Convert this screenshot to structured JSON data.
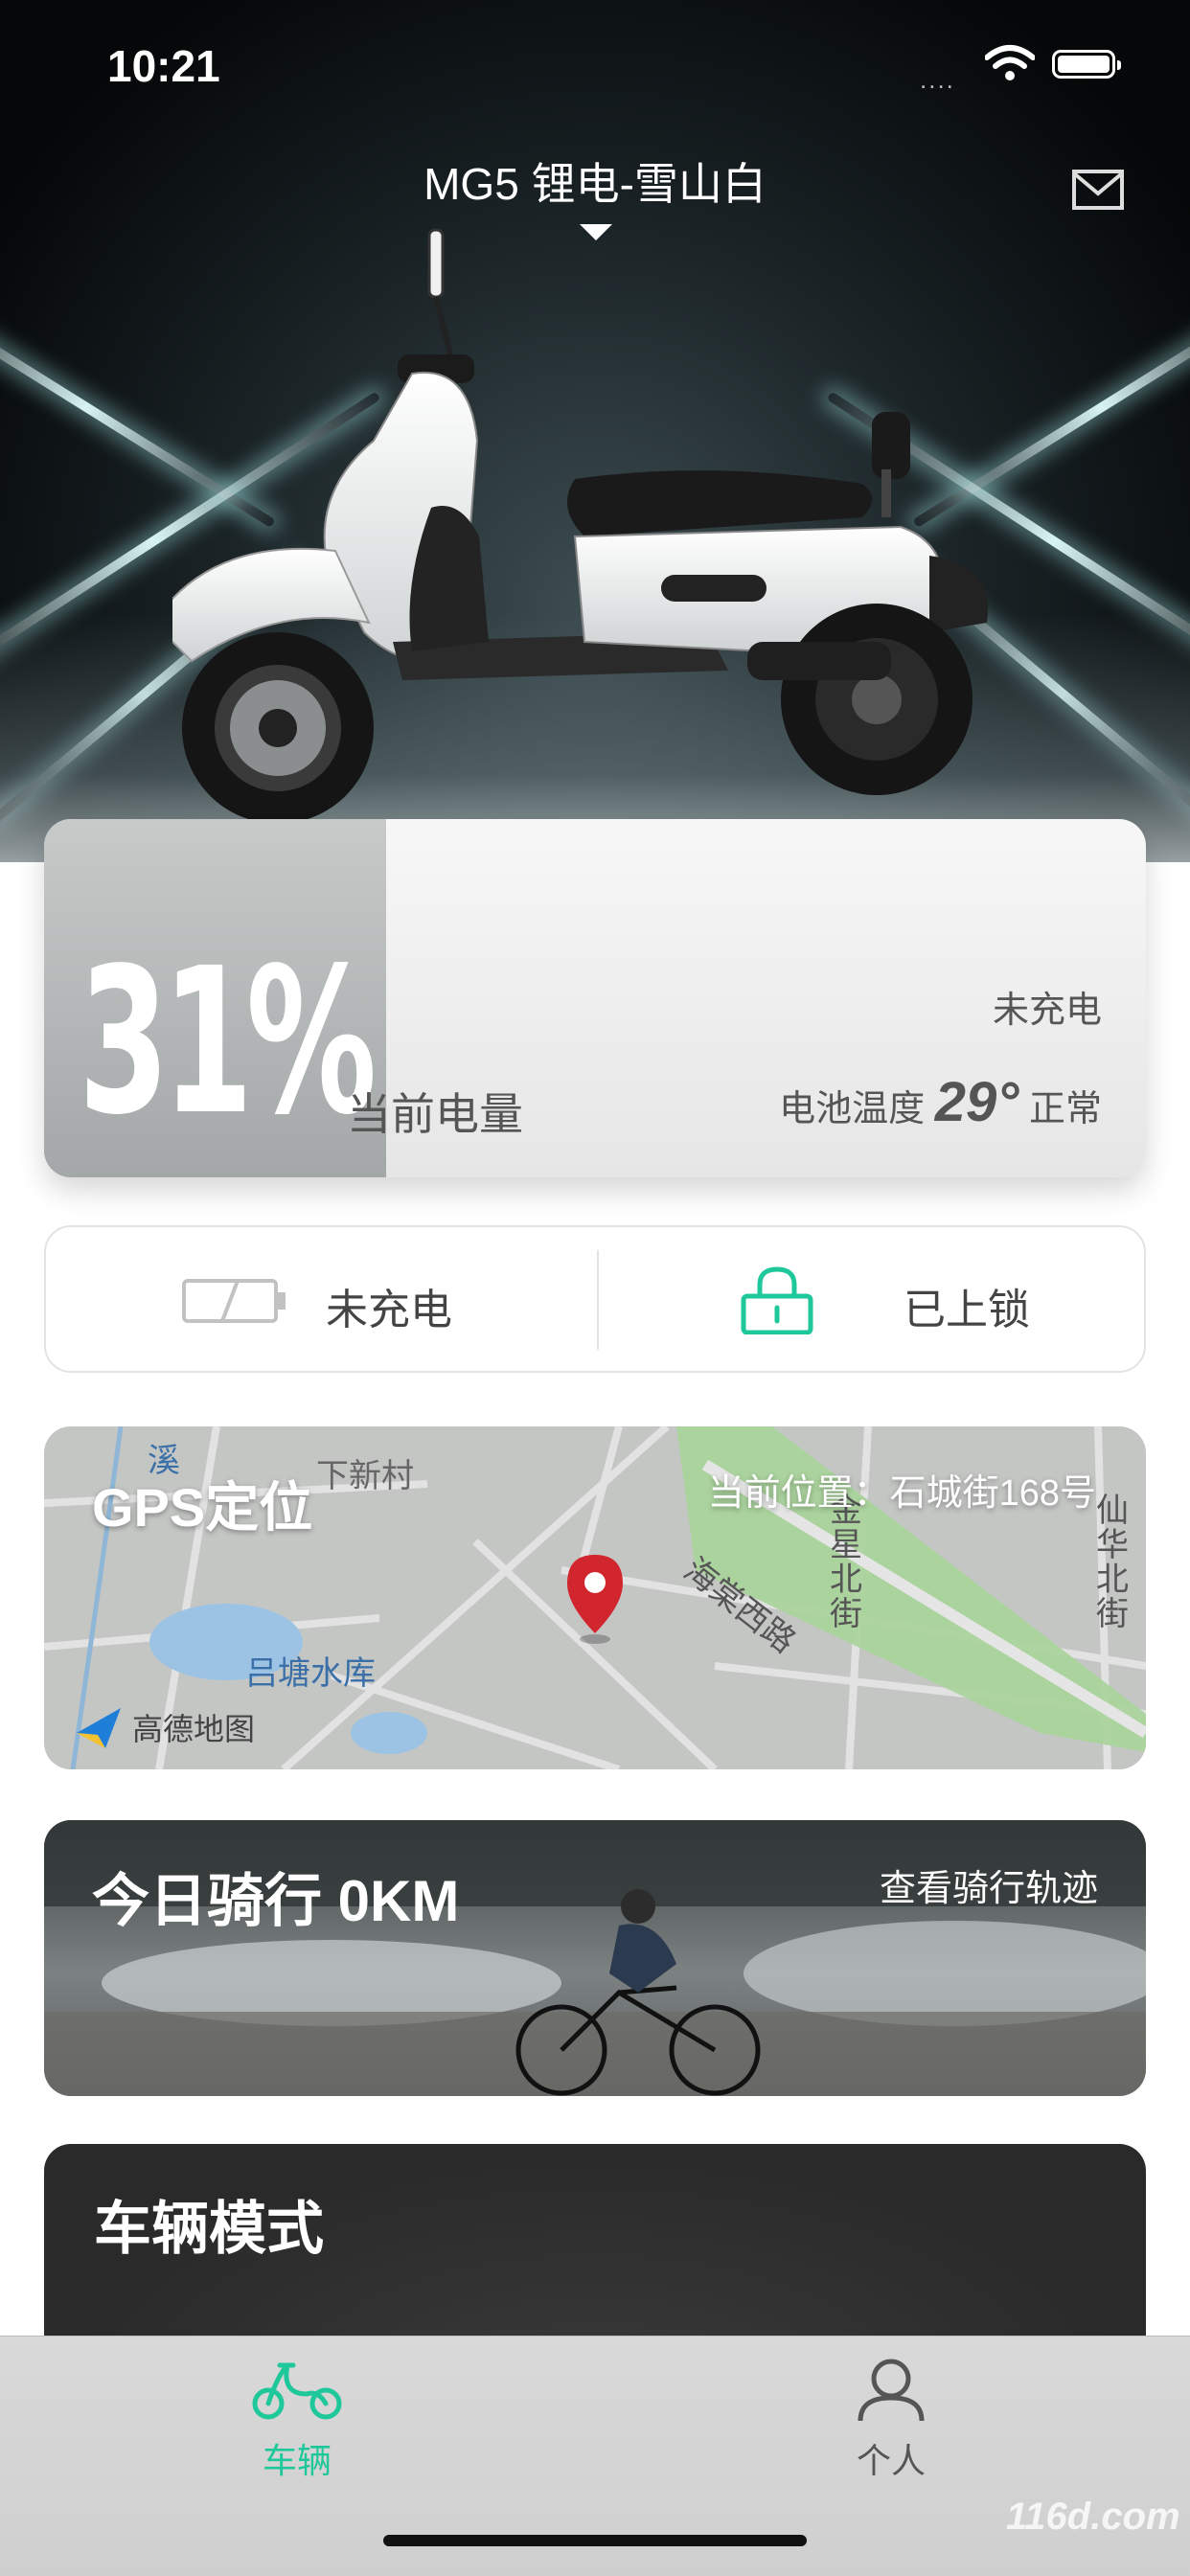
{
  "status_bar": {
    "time": "10:21",
    "signal": "....",
    "wifi_icon": "wifi-icon",
    "battery_icon": "battery-icon"
  },
  "header": {
    "vehicle_name": "MG5 锂电-雪山白",
    "dropdown_icon": "caret-down-icon",
    "message_icon": "mail-icon"
  },
  "battery_card": {
    "percent": "31%",
    "percent_value": 31,
    "label": "当前电量",
    "charge_status": "未充电",
    "temp_label": "电池温度",
    "temp_value": "29°",
    "temp_status": "正常"
  },
  "status_row": {
    "charge": {
      "label": "未充电",
      "icon": "battery-outline-icon"
    },
    "lock": {
      "label": "已上锁",
      "icon": "lock-icon",
      "color": "#1fc89a"
    }
  },
  "gps": {
    "title": "GPS定位",
    "location": "当前位置：石城街168号",
    "map_labels": [
      "下新村",
      "吕塘水库",
      "海棠西路",
      "金星北街",
      "仙华北街",
      "溪"
    ],
    "map_provider": "高德地图"
  },
  "ride": {
    "title": "今日骑行 0KM",
    "link": "查看骑行轨迹"
  },
  "mode": {
    "title": "车辆模式"
  },
  "tabbar": {
    "items": [
      {
        "label": "车辆",
        "icon": "scooter-icon",
        "active": true
      },
      {
        "label": "个人",
        "icon": "person-icon",
        "active": false
      }
    ],
    "active_color": "#1fc89a",
    "inactive_color": "#555555"
  },
  "watermark": "116d.com"
}
